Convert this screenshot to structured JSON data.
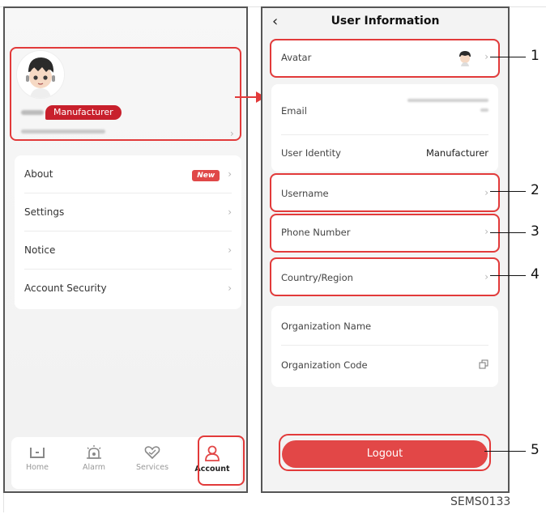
{
  "left_panel": {
    "profile": {
      "role_badge": "Manufacturer"
    },
    "menu": [
      {
        "label": "About",
        "badge": "New"
      },
      {
        "label": "Settings"
      },
      {
        "label": "Notice"
      },
      {
        "label": "Account Security"
      }
    ],
    "tabs": [
      {
        "label": "Home",
        "icon": "home-icon"
      },
      {
        "label": "Alarm",
        "icon": "alarm-icon"
      },
      {
        "label": "Services",
        "icon": "services-icon"
      },
      {
        "label": "Account",
        "icon": "account-icon",
        "active": true
      }
    ]
  },
  "right_panel": {
    "title": "User Information",
    "back_icon": "chevron-left-icon",
    "avatar_label": "Avatar",
    "email_label": "Email",
    "user_identity_label": "User Identity",
    "user_identity_value": "Manufacturer",
    "username_label": "Username",
    "phone_label": "Phone Number",
    "country_label": "Country/Region",
    "org_name_label": "Organization Name",
    "org_code_label": "Organization Code",
    "logout_label": "Logout"
  },
  "callouts": [
    "1",
    "2",
    "3",
    "4",
    "5"
  ],
  "figure_code": "SEMS0133",
  "colors": {
    "accent": "#e24747",
    "highlight": "#e23a3a",
    "badge": "#c8202c"
  }
}
